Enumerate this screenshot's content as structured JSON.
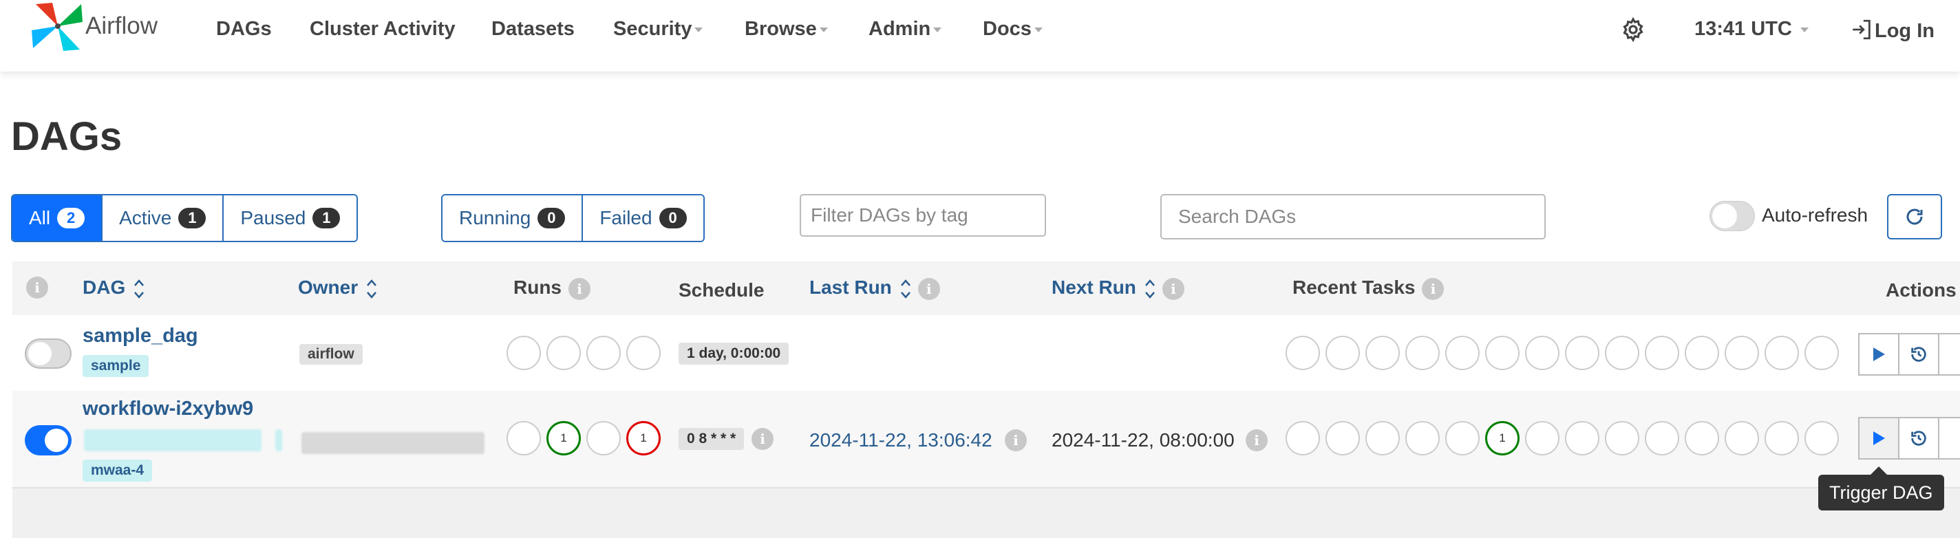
{
  "nav": {
    "brand": "Airflow",
    "menu": [
      "DAGs",
      "Cluster Activity",
      "Datasets",
      "Security",
      "Browse",
      "Admin",
      "Docs"
    ],
    "time": "13:41 UTC",
    "login": "Log In"
  },
  "page_title": "DAGs",
  "filters": {
    "status": [
      {
        "label": "All",
        "count": "2",
        "active": true
      },
      {
        "label": "Active",
        "count": "1"
      },
      {
        "label": "Paused",
        "count": "1"
      }
    ],
    "runs": [
      {
        "label": "Running",
        "count": "0"
      },
      {
        "label": "Failed",
        "count": "0"
      }
    ],
    "tag_placeholder": "Filter DAGs by tag",
    "search_placeholder": "Search DAGs",
    "auto_refresh_label": "Auto-refresh"
  },
  "table": {
    "headers": {
      "dag": "DAG",
      "owner": "Owner",
      "runs": "Runs",
      "schedule": "Schedule",
      "last_run": "Last Run",
      "next_run": "Next Run",
      "recent_tasks": "Recent Tasks",
      "actions": "Actions"
    },
    "info_glyph": "i",
    "rows": [
      {
        "name": "sample_dag",
        "tags": [
          "sample"
        ],
        "owner": "airflow",
        "schedule": "1 day, 0:00:00",
        "last_run": "",
        "next_run": "",
        "paused": true
      },
      {
        "name": "workflow-i2xybw9",
        "tags": [
          "mwaa-4"
        ],
        "owner": "",
        "schedule": "0 8 * * *",
        "last_run": "2024-11-22, 13:06:42",
        "next_run": "2024-11-22, 08:00:00",
        "paused": false,
        "runs_success": "1",
        "runs_failed": "1",
        "task_success": "1"
      }
    ]
  },
  "tooltip": "Trigger DAG",
  "colors": {
    "primary": "#0d6efd",
    "link": "#2a5d8f",
    "success": "#008000",
    "failed": "#e00000"
  }
}
